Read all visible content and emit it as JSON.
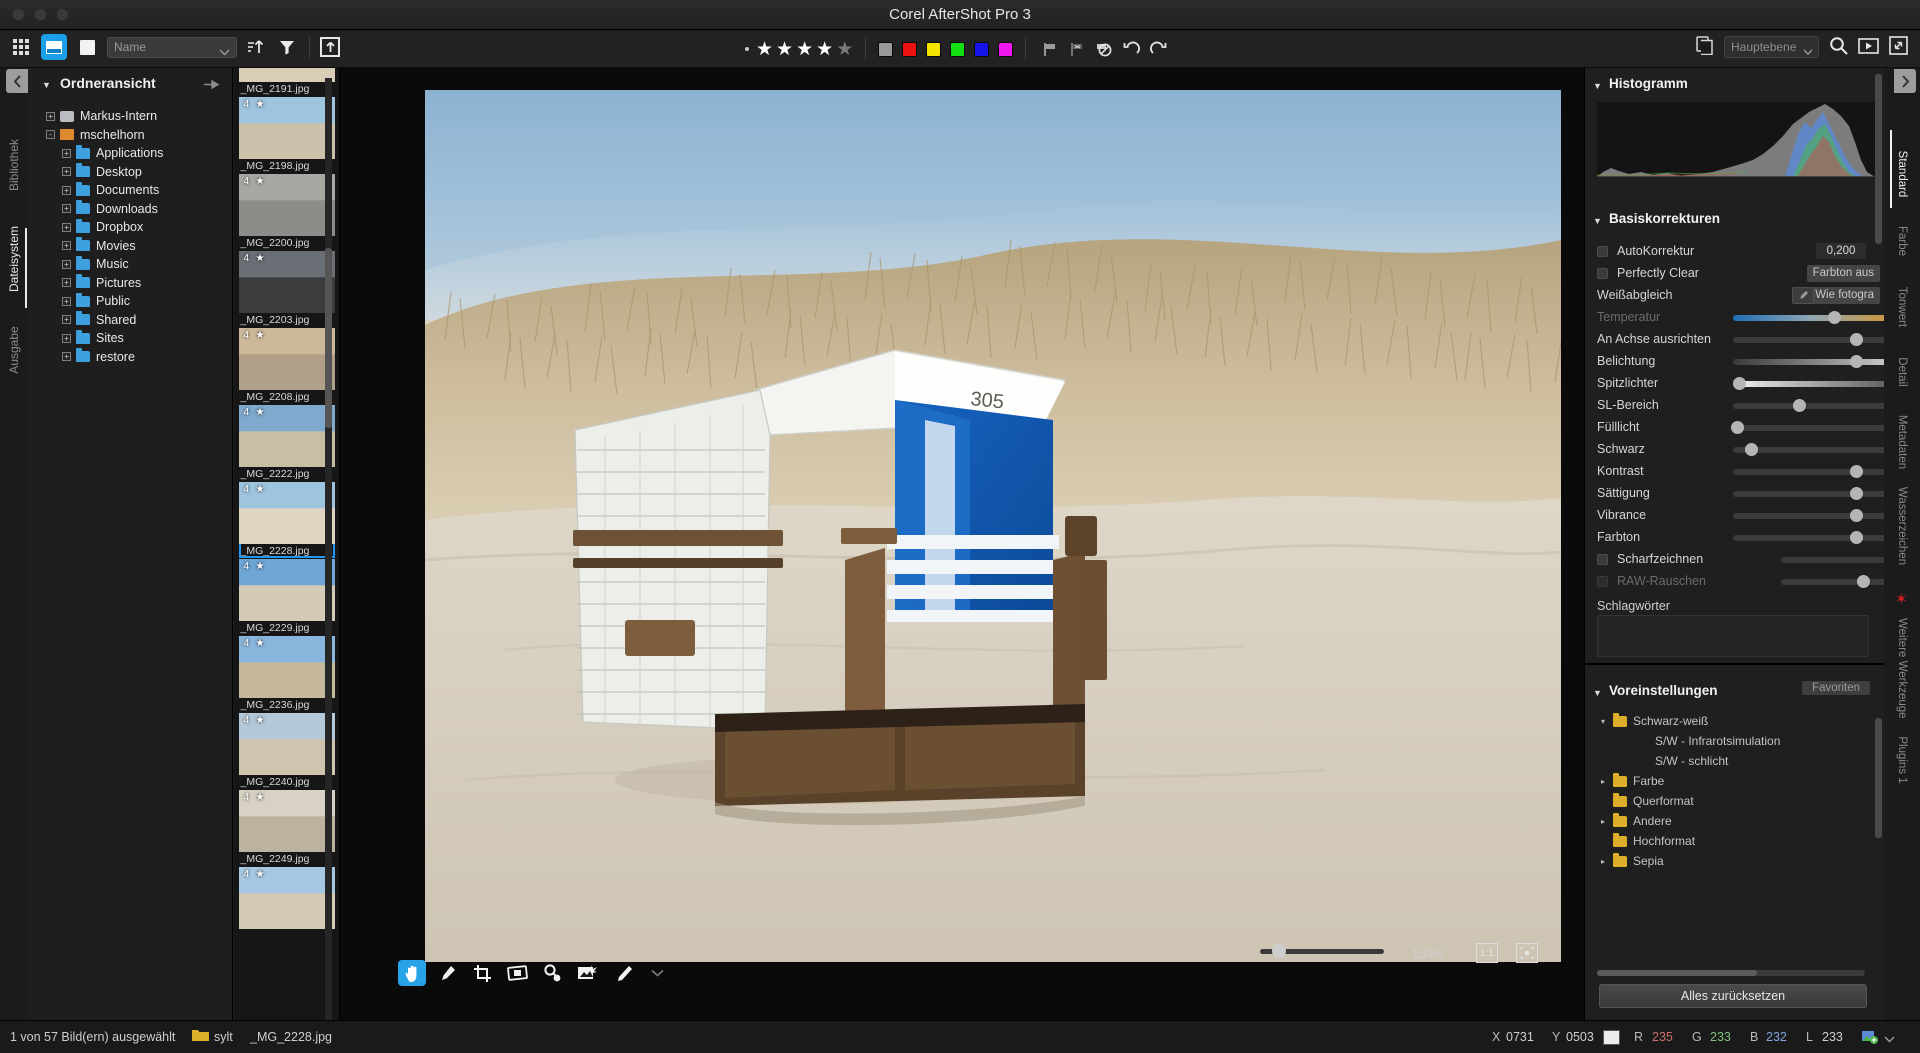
{
  "window": {
    "title": "Corel AfterShot Pro 3"
  },
  "toolbar": {
    "view_grid_icon": "grid-view-icon",
    "view_filmstrip_icon": "filmstrip-view-icon",
    "view_single_icon": "single-view-icon",
    "sort_value": "Name",
    "sort_asc_icon": "sort-ascending-icon",
    "filter_icon": "filter-icon",
    "export_icon": "export-up-icon",
    "rating_dot_icon": "no-rating-dot-icon",
    "rating_value": 4,
    "rating_max": 5,
    "color_labels": [
      "#9a9a9a",
      "#ee1111",
      "#f5e400",
      "#12e012",
      "#1414e8",
      "#f018f0"
    ],
    "flag_icon": "flag-icon",
    "flag_reject_icon": "flag-reject-icon",
    "flag_none_icon": "flag-none-icon",
    "rotate_left_icon": "rotate-left-icon",
    "rotate_right_icon": "rotate-right-icon",
    "copy_icon": "copy-layer-icon",
    "layer_value": "Hauptebene",
    "search_icon": "search-icon",
    "slideshow_icon": "slideshow-icon",
    "fullscreen_icon": "fullscreen-icon"
  },
  "left_rail": {
    "items": [
      "Bibliothek",
      "Dateisystem",
      "Ausgabe"
    ],
    "selected": "Dateisystem"
  },
  "folder_panel": {
    "title": "Ordneransicht",
    "collapse_icon": "chevron-left-icon",
    "pin_icon": "pin-icon",
    "tree": [
      {
        "label": "Markus-Intern",
        "depth": 0,
        "icon": "disk-icon",
        "expander": "+"
      },
      {
        "label": "mschelhorn",
        "depth": 0,
        "icon": "home-icon",
        "expander": "-"
      },
      {
        "label": "Applications",
        "depth": 1,
        "icon": "folder-apps-icon",
        "expander": "+"
      },
      {
        "label": "Desktop",
        "depth": 1,
        "icon": "folder-desktop-icon",
        "expander": "+"
      },
      {
        "label": "Documents",
        "depth": 1,
        "icon": "folder-documents-icon",
        "expander": "+"
      },
      {
        "label": "Downloads",
        "depth": 1,
        "icon": "folder-downloads-icon",
        "expander": "+"
      },
      {
        "label": "Dropbox",
        "depth": 1,
        "icon": "folder-dropbox-icon",
        "expander": "+"
      },
      {
        "label": "Movies",
        "depth": 1,
        "icon": "folder-movies-icon",
        "expander": "+"
      },
      {
        "label": "Music",
        "depth": 1,
        "icon": "folder-music-icon",
        "expander": "+"
      },
      {
        "label": "Pictures",
        "depth": 1,
        "icon": "folder-pictures-icon",
        "expander": "+"
      },
      {
        "label": "Public",
        "depth": 1,
        "icon": "folder-public-icon",
        "expander": "+"
      },
      {
        "label": "Shared",
        "depth": 1,
        "icon": "folder-shared-icon",
        "expander": "+"
      },
      {
        "label": "Sites",
        "depth": 1,
        "icon": "folder-sites-icon",
        "expander": "+"
      },
      {
        "label": "restore",
        "depth": 1,
        "icon": "folder-restore-icon",
        "expander": "+"
      }
    ]
  },
  "filmstrip": {
    "thumbs": [
      {
        "name": "_MG_2191.jpg",
        "rating": "",
        "c1": "#b9a98f",
        "c2": "#d9cdb6",
        "selected": false,
        "partial": true
      },
      {
        "name": "_MG_2198.jpg",
        "rating": "4",
        "c1": "#9fc4de",
        "c2": "#ccc2ab",
        "selected": false
      },
      {
        "name": "_MG_2200.jpg",
        "rating": "4",
        "c1": "#a8a7a2",
        "c2": "#8d8c88",
        "selected": false
      },
      {
        "name": "_MG_2203.jpg",
        "rating": "4",
        "c1": "#6a6f75",
        "c2": "#3a3c3e",
        "selected": false
      },
      {
        "name": "_MG_2208.jpg",
        "rating": "4",
        "c1": "#cdb89a",
        "c2": "#b0a08a",
        "selected": false
      },
      {
        "name": "_MG_2222.jpg",
        "rating": "4",
        "c1": "#7fa9cd",
        "c2": "#c9bda4",
        "selected": false
      },
      {
        "name": "_MG_2228.jpg",
        "rating": "4",
        "c1": "#9ec4e0",
        "c2": "#ded5c3",
        "selected": true
      },
      {
        "name": "_MG_2229.jpg",
        "rating": "4",
        "c1": "#6fa6d6",
        "c2": "#d3cbb8",
        "selected": false
      },
      {
        "name": "_MG_2236.jpg",
        "rating": "4",
        "c1": "#89b6dc",
        "c2": "#c5b89d",
        "selected": false
      },
      {
        "name": "_MG_2240.jpg",
        "rating": "4",
        "c1": "#b4c8d8",
        "c2": "#cfc4ae",
        "selected": false
      },
      {
        "name": "_MG_2249.jpg",
        "rating": "4",
        "c1": "#d8d2c4",
        "c2": "#bdb2a0",
        "selected": false
      },
      {
        "name": "",
        "rating": "4",
        "c1": "#a7c8e2",
        "c2": "#d5cab5",
        "selected": false,
        "partial": true
      }
    ]
  },
  "viewer": {
    "tools": [
      {
        "icon": "hand-pan-icon",
        "active": true
      },
      {
        "icon": "eyedropper-icon",
        "active": false
      },
      {
        "icon": "crop-icon",
        "active": false
      },
      {
        "icon": "straighten-icon",
        "active": false
      },
      {
        "icon": "redeye-icon",
        "active": false
      },
      {
        "icon": "heal-clone-icon",
        "active": false
      },
      {
        "icon": "brush-icon",
        "active": false
      },
      {
        "icon": "chevron-down-icon",
        "active": false
      }
    ],
    "zoom_label": "100%",
    "zoom_1to1_icon": "zoom-1-1-icon",
    "zoom_fit_icon": "zoom-fit-icon"
  },
  "right_panel": {
    "histogram": {
      "title": "Histogramm"
    },
    "basic": {
      "title": "Basiskorrekturen",
      "rows": [
        {
          "type": "check-num",
          "label": "AutoKorrektur",
          "checked": false,
          "value": "0,200"
        },
        {
          "type": "check-btn",
          "label": "Perfectly Clear",
          "checked": false,
          "button": "Farbton aus"
        },
        {
          "type": "label-btn",
          "label": "Weißabgleich",
          "eyedropper": "eyedropper-icon",
          "button": "Wie fotogra"
        },
        {
          "type": "slider-temp",
          "label": "Temperatur",
          "dim": true,
          "pos": 52
        },
        {
          "type": "slider",
          "label": "An Achse ausrichten",
          "pos": 63
        },
        {
          "type": "slider-exp",
          "label": "Belichtung",
          "pos": 63
        },
        {
          "type": "slider-hl",
          "label": "Spitzlichter",
          "pos": 3
        },
        {
          "type": "slider",
          "label": "SL-Bereich",
          "pos": 34
        },
        {
          "type": "slider",
          "label": "Fülllicht",
          "pos": 2
        },
        {
          "type": "slider",
          "label": "Schwarz",
          "pos": 9
        },
        {
          "type": "slider",
          "label": "Kontrast",
          "pos": 63
        },
        {
          "type": "slider",
          "label": "Sättigung",
          "pos": 63
        },
        {
          "type": "slider",
          "label": "Vibrance",
          "pos": 63
        },
        {
          "type": "slider",
          "label": "Farbton",
          "pos": 63
        },
        {
          "type": "check-slider",
          "label": "Scharfzeichnen",
          "checked": false,
          "pos": 74
        },
        {
          "type": "check-slider",
          "label": "RAW-Rauschen",
          "checked": false,
          "dim": true,
          "pos": 56
        }
      ],
      "keywords_label": "Schlagwörter",
      "keywords_value": ""
    },
    "presets": {
      "title": "Voreinstellungen",
      "favorites_label": "Favoriten",
      "items": [
        {
          "label": "Schwarz-weiß",
          "depth": 0,
          "arrow": "▾",
          "folder": true
        },
        {
          "label": "S/W - Infrarotsimulation",
          "depth": 1,
          "arrow": "",
          "folder": false
        },
        {
          "label": "S/W - schlicht",
          "depth": 1,
          "arrow": "",
          "folder": false
        },
        {
          "label": "Farbe",
          "depth": 0,
          "arrow": "▸",
          "folder": true
        },
        {
          "label": "Querformat",
          "depth": 0,
          "arrow": "",
          "folder": true
        },
        {
          "label": "Andere",
          "depth": 0,
          "arrow": "▸",
          "folder": true
        },
        {
          "label": "Hochformat",
          "depth": 0,
          "arrow": "",
          "folder": true
        },
        {
          "label": "Sepia",
          "depth": 0,
          "arrow": "▸",
          "folder": true
        }
      ]
    },
    "reset_button": "Alles zurücksetzen"
  },
  "right_rail": {
    "items": [
      "Standard",
      "Farbe",
      "Tonwert",
      "Detail",
      "Metadaten",
      "Wasserzeichen",
      "Weitere Werkzeuge",
      "Plugins 1"
    ],
    "selected": "Standard",
    "expand_icon": "chevron-right-icon",
    "asterisk_icon": "asterisk-icon"
  },
  "statusbar": {
    "selection": "1 von 57 Bild(ern) ausgewählt",
    "folder_icon": "folder-icon",
    "folder": "sylt",
    "filename": "_MG_2228.jpg",
    "coord_x_label": "X",
    "coord_x": "0731",
    "coord_y_label": "Y",
    "coord_y": "0503",
    "color_swatch": "#ececea",
    "r_label": "R",
    "r_value": "235",
    "g_label": "G",
    "g_value": "233",
    "b_label": "B",
    "b_value": "232",
    "l_label": "L",
    "l_value": "233",
    "color_profile_icon": "color-profile-icon",
    "chevron_icon": "chevron-down-icon",
    "card_icon": "card-icon",
    "lock_icon": "lock-icon",
    "warning_icon": "warning-icon"
  },
  "colors": {
    "accent": "#1b9fe8",
    "selection": "#2196f3",
    "panel_bg": "#1f1f1f",
    "rule_red": "#c84a4a",
    "rule_green": "#4ab44a",
    "rule_blue": "#5a8ad8"
  }
}
